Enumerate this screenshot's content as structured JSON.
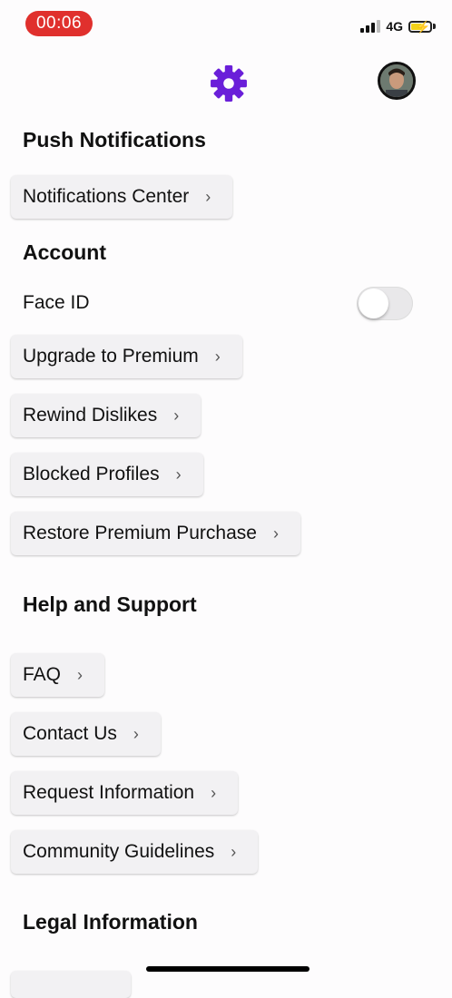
{
  "status_bar": {
    "time": "00:06",
    "network": "4G",
    "battery_charging": true
  },
  "header": {
    "settings_icon": "gear-icon",
    "accent_color": "#6a1fd9",
    "profile_avatar": "avatar"
  },
  "sections": {
    "push_notifications": {
      "title": "Push Notifications",
      "items": [
        "Notifications Center"
      ]
    },
    "account": {
      "title": "Account",
      "face_id_label": "Face ID",
      "face_id_enabled": false,
      "items": [
        "Upgrade to Premium",
        "Rewind Dislikes",
        "Blocked Profiles",
        "Restore Premium Purchase"
      ]
    },
    "help": {
      "title": "Help and Support",
      "items": [
        "FAQ",
        "Contact Us",
        "Request Information",
        "Community Guidelines"
      ]
    },
    "legal": {
      "title": "Legal Information"
    }
  },
  "chevron": "›"
}
